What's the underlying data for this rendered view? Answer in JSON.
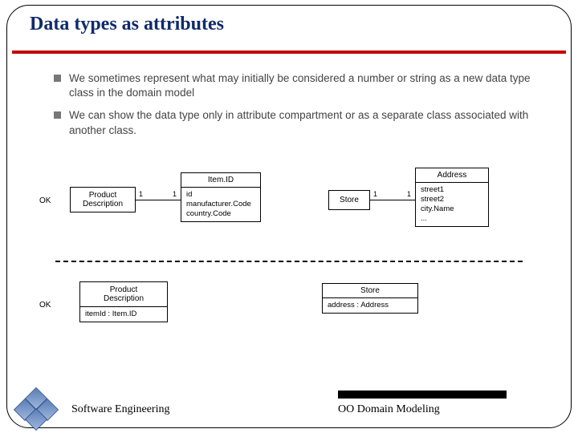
{
  "title": "Data types as attributes",
  "bullets": [
    "We sometimes represent what may initially be considered a number or string as a new data type class in the domain model",
    "We can show the data type only in attribute compartment or as a separate class associated with another class."
  ],
  "labels": {
    "ok": "OK"
  },
  "diagram": {
    "row1": {
      "left": {
        "class1": "Product\nDescription",
        "class2_title": "Item.ID",
        "class2_attrs": "id\nmanufacturer.Code\ncountry.Code",
        "mult_a": "1",
        "mult_b": "1"
      },
      "right": {
        "class1": "Store",
        "class2_title": "Address",
        "class2_attrs": "street1\nstreet2\ncity.Name\n...",
        "mult_a": "1",
        "mult_b": "1"
      }
    },
    "row2": {
      "left": {
        "title": "Product\nDescription",
        "attr": "itemId : Item.ID"
      },
      "right": {
        "title": "Store",
        "attr": "address : Address"
      }
    }
  },
  "footer": {
    "left": "Software Engineering",
    "right": "OO Domain Modeling"
  }
}
